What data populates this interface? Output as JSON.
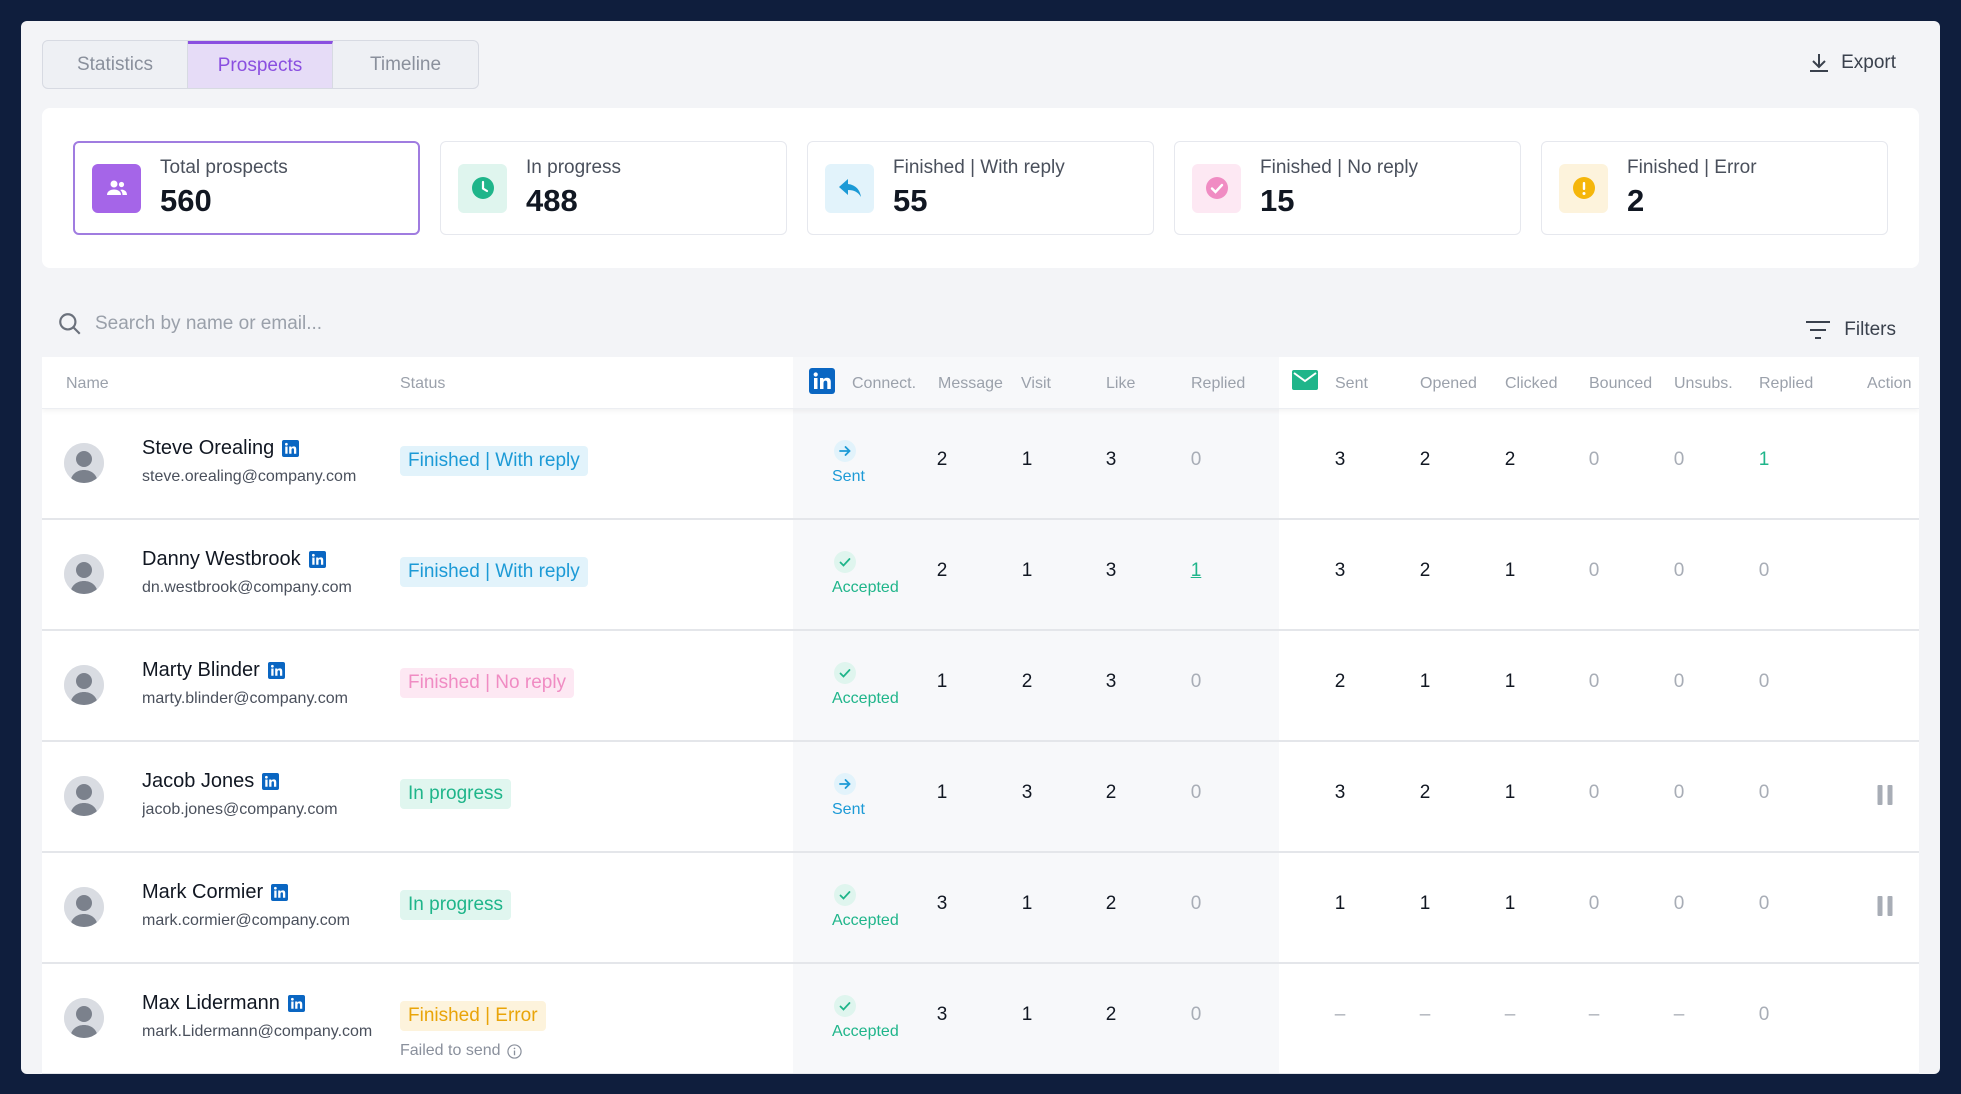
{
  "tabs": [
    {
      "label": "Statistics",
      "active": false
    },
    {
      "label": "Prospects",
      "active": true
    },
    {
      "label": "Timeline",
      "active": false
    }
  ],
  "export_label": "Export",
  "stats": [
    {
      "label": "Total prospects",
      "value": "560",
      "icon": "people-icon",
      "color": "#a565e8",
      "bg": "#a565e8",
      "active": true
    },
    {
      "label": "In progress",
      "value": "488",
      "icon": "clock-icon",
      "color": "#1fb58a",
      "bg": "#dff5ee",
      "active": false
    },
    {
      "label": "Finished | With reply",
      "value": "55",
      "icon": "reply-icon",
      "color": "#1c9ad6",
      "bg": "#e2f3fb",
      "active": false
    },
    {
      "label": "Finished | No reply",
      "value": "15",
      "icon": "check-circle-icon",
      "color": "#f08cc3",
      "bg": "#fde8f3",
      "active": false
    },
    {
      "label": "Finished | Error",
      "value": "2",
      "icon": "alert-icon",
      "color": "#f5b60b",
      "bg": "#fdf3dc",
      "active": false
    }
  ],
  "search": {
    "placeholder": "Search by name or email..."
  },
  "filters_label": "Filters",
  "columns": {
    "name": "Name",
    "status": "Status",
    "connect": "Connect.",
    "message": "Message",
    "visit": "Visit",
    "like": "Like",
    "li_replied": "Replied",
    "sent": "Sent",
    "opened": "Opened",
    "clicked": "Clicked",
    "bounced": "Bounced",
    "unsubs": "Unsubs.",
    "em_replied": "Replied",
    "action": "Action"
  },
  "rows": [
    {
      "name": "Steve Orealing",
      "email": "steve.orealing@company.com",
      "status": "Finished | With reply",
      "status_type": "reply",
      "note": "",
      "connect": "Sent",
      "message": "2",
      "visit": "1",
      "like": "3",
      "li_replied": "0",
      "sent": "3",
      "opened": "2",
      "clicked": "2",
      "bounced": "0",
      "unsubs": "0",
      "em_replied": "1",
      "action": ""
    },
    {
      "name": "Danny Westbrook",
      "email": "dn.westbrook@company.com",
      "status": "Finished | With reply",
      "status_type": "reply",
      "note": "",
      "connect": "Accepted",
      "message": "2",
      "visit": "1",
      "like": "3",
      "li_replied": "1",
      "sent": "3",
      "opened": "2",
      "clicked": "1",
      "bounced": "0",
      "unsubs": "0",
      "em_replied": "0",
      "action": ""
    },
    {
      "name": "Marty Blinder",
      "email": "marty.blinder@company.com",
      "status": "Finished | No reply",
      "status_type": "noreply",
      "note": "",
      "connect": "Accepted",
      "message": "1",
      "visit": "2",
      "like": "3",
      "li_replied": "0",
      "sent": "2",
      "opened": "1",
      "clicked": "1",
      "bounced": "0",
      "unsubs": "0",
      "em_replied": "0",
      "action": ""
    },
    {
      "name": "Jacob Jones",
      "email": "jacob.jones@company.com",
      "status": "In progress",
      "status_type": "progress",
      "note": "",
      "connect": "Sent",
      "message": "1",
      "visit": "3",
      "like": "2",
      "li_replied": "0",
      "sent": "3",
      "opened": "2",
      "clicked": "1",
      "bounced": "0",
      "unsubs": "0",
      "em_replied": "0",
      "action": "pause"
    },
    {
      "name": "Mark Cormier",
      "email": "mark.cormier@company.com",
      "status": "In progress",
      "status_type": "progress",
      "note": "",
      "connect": "Accepted",
      "message": "3",
      "visit": "1",
      "like": "2",
      "li_replied": "0",
      "sent": "1",
      "opened": "1",
      "clicked": "1",
      "bounced": "0",
      "unsubs": "0",
      "em_replied": "0",
      "action": "pause"
    },
    {
      "name": "Max Lidermann",
      "email": "mark.Lidermann@company.com",
      "status": "Finished | Error",
      "status_type": "error",
      "note": "Failed to send",
      "connect": "Accepted",
      "message": "3",
      "visit": "1",
      "like": "2",
      "li_replied": "0",
      "sent": "–",
      "opened": "–",
      "clicked": "–",
      "bounced": "–",
      "unsubs": "–",
      "em_replied": "0",
      "action": ""
    }
  ]
}
